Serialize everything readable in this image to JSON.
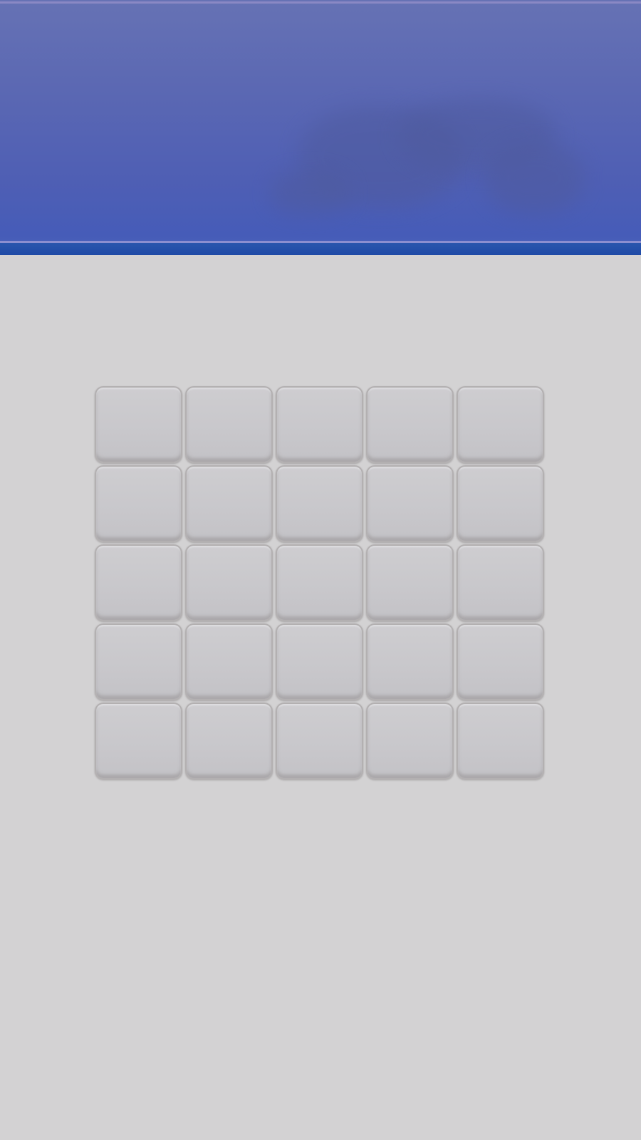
{
  "header": {
    "colors": {
      "gradient_top": "#6672b4",
      "gradient_bottom": "#465cb8",
      "base_bar": "#1f4aa6"
    }
  },
  "board": {
    "rows": 5,
    "columns": 5,
    "tiles": [
      {
        "row": 1,
        "col": 1,
        "state": "blank"
      },
      {
        "row": 1,
        "col": 2,
        "state": "blank"
      },
      {
        "row": 1,
        "col": 3,
        "state": "blank"
      },
      {
        "row": 1,
        "col": 4,
        "state": "blank"
      },
      {
        "row": 1,
        "col": 5,
        "state": "blank"
      },
      {
        "row": 2,
        "col": 1,
        "state": "blank"
      },
      {
        "row": 2,
        "col": 2,
        "state": "blank"
      },
      {
        "row": 2,
        "col": 3,
        "state": "blank"
      },
      {
        "row": 2,
        "col": 4,
        "state": "blank"
      },
      {
        "row": 2,
        "col": 5,
        "state": "blank"
      },
      {
        "row": 3,
        "col": 1,
        "state": "blank"
      },
      {
        "row": 3,
        "col": 2,
        "state": "blank"
      },
      {
        "row": 3,
        "col": 3,
        "state": "blank"
      },
      {
        "row": 3,
        "col": 4,
        "state": "blank"
      },
      {
        "row": 3,
        "col": 5,
        "state": "blank"
      },
      {
        "row": 4,
        "col": 1,
        "state": "blank"
      },
      {
        "row": 4,
        "col": 2,
        "state": "blank"
      },
      {
        "row": 4,
        "col": 3,
        "state": "blank"
      },
      {
        "row": 4,
        "col": 4,
        "state": "blank"
      },
      {
        "row": 4,
        "col": 5,
        "state": "blank"
      },
      {
        "row": 5,
        "col": 1,
        "state": "blank"
      },
      {
        "row": 5,
        "col": 2,
        "state": "blank"
      },
      {
        "row": 5,
        "col": 3,
        "state": "blank"
      },
      {
        "row": 5,
        "col": 4,
        "state": "blank"
      },
      {
        "row": 5,
        "col": 5,
        "state": "blank"
      }
    ],
    "colors": {
      "tile_fill": "#c8c7cb",
      "tile_border": "#b3b0b1",
      "page_background": "#d3d2d3"
    }
  }
}
